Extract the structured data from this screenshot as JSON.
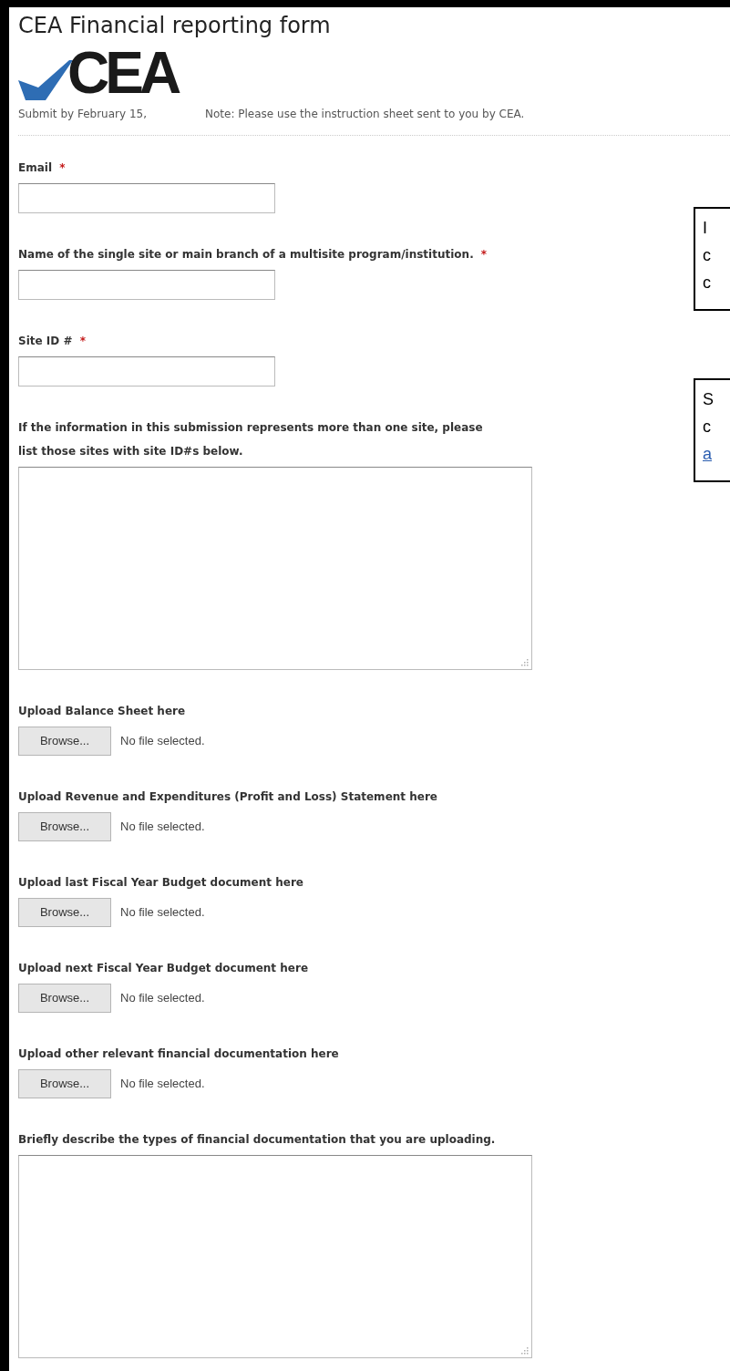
{
  "title": "CEA Financial reporting form",
  "logo": {
    "text": "CEA"
  },
  "deadline": "Submit by February 15,",
  "note": "Note: Please use the instruction sheet sent to you by CEA.",
  "fields": [
    {
      "kind": "text",
      "label": "Email",
      "required_mark": "*"
    },
    {
      "kind": "text",
      "label": "Name of the single site or main branch of a multisite program/institution.",
      "required_mark": "*"
    },
    {
      "kind": "text",
      "label": "Site ID #",
      "required_mark": "*"
    },
    {
      "kind": "textarea",
      "label": "If the information in this submission represents more than one site, please list those sites with site ID#s below."
    },
    {
      "kind": "file",
      "label": "Upload Balance Sheet here",
      "button": "Browse...",
      "status": "No file selected."
    },
    {
      "kind": "file",
      "label": "Upload Revenue and Expenditures (Profit and Loss) Statement here",
      "button": "Browse...",
      "status": "No file selected."
    },
    {
      "kind": "file",
      "label": "Upload last Fiscal Year Budget document here",
      "button": "Browse...",
      "status": "No file selected."
    },
    {
      "kind": "file",
      "label": "Upload next Fiscal Year Budget document here",
      "button": "Browse...",
      "status": "No file selected."
    },
    {
      "kind": "file",
      "label": "Upload other relevant financial documentation here",
      "button": "Browse...",
      "status": "No file selected."
    },
    {
      "kind": "textarea",
      "label": "Briefly describe the types of financial documentation that you are uploading."
    }
  ],
  "side_boxes": [
    {
      "lines": [
        {
          "kind": "text",
          "text": "I"
        },
        {
          "kind": "text",
          "text": "c"
        },
        {
          "kind": "text",
          "text": "c"
        }
      ]
    },
    {
      "lines": [
        {
          "kind": "text",
          "text": "S"
        },
        {
          "kind": "text",
          "text": "c"
        },
        {
          "kind": "link",
          "text": "a"
        }
      ]
    }
  ]
}
